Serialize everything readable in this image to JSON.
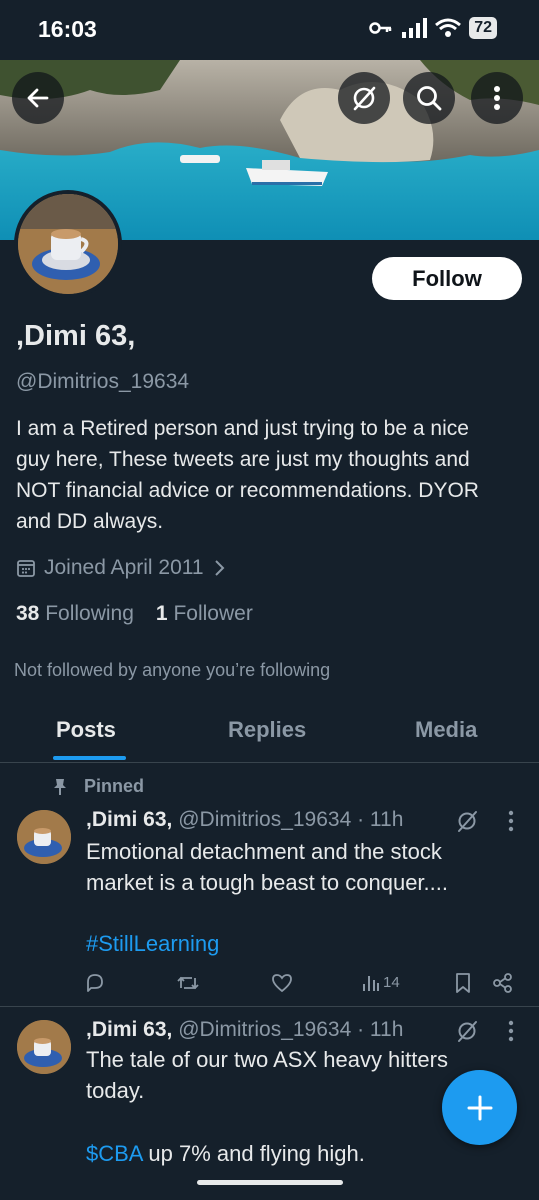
{
  "status": {
    "time": "16:03",
    "battery": "72"
  },
  "profile": {
    "name": ",Dimi 63,",
    "handle": "@Dimitrios_19634",
    "bio": "I am a Retired person and just trying to be a nice guy here,  These tweets are just my thoughts and NOT financial advice or recommendations. DYOR and DD always.",
    "joined": "Joined April 2011",
    "following_count": "38",
    "following_label": "Following",
    "followers_count": "1",
    "followers_label": "Follower",
    "not_followed": "Not followed by anyone you’re following",
    "follow_button": "Follow"
  },
  "tabs": [
    "Posts",
    "Replies",
    "Media"
  ],
  "tweets": [
    {
      "pinned_label": "Pinned",
      "name": ",Dimi 63,",
      "meta": "@Dimitrios_19634 · 11h",
      "text": "Emotional detachment and the stock market is a tough beast to conquer....",
      "hashtag": "#StillLearning",
      "views": "14"
    },
    {
      "name": ",Dimi 63,",
      "meta": "@Dimitrios_19634 · 11h",
      "text": "The tale of our two ASX heavy hitters today.",
      "cashtag": "$CBA",
      "cashtag_rest": " up 7% and flying high."
    }
  ],
  "icons": {
    "back": "back-arrow-icon",
    "grok": "grok-icon",
    "search": "search-icon",
    "more": "more-vertical-icon",
    "calendar": "calendar-icon",
    "pin": "pin-icon",
    "reply": "reply-icon",
    "retweet": "retweet-icon",
    "like": "heart-icon",
    "views": "views-icon",
    "bookmark": "bookmark-icon",
    "share": "share-icon",
    "compose": "plus-icon"
  },
  "colors": {
    "background": "#15202b",
    "accent": "#1d9bf0",
    "secondary_text": "#8b98a5"
  }
}
